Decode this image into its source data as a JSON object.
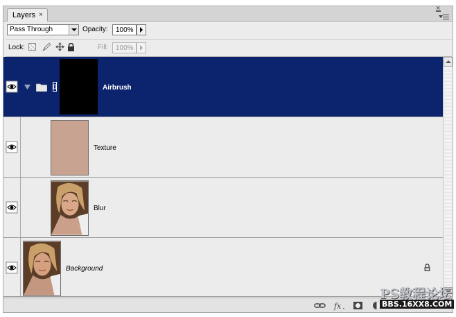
{
  "panel": {
    "tab_label": "Layers",
    "tab_close": "×",
    "close_glyph": "×"
  },
  "options": {
    "blend_mode": "Pass Through",
    "opacity_label": "Opacity:",
    "opacity_value": "100%",
    "lock_label": "Lock:",
    "fill_label": "Fill:",
    "fill_value": "100%"
  },
  "layers": [
    {
      "name": "Airbrush",
      "type": "group",
      "selected": true,
      "visible": true
    },
    {
      "name": "Texture",
      "type": "clipped",
      "visible": true
    },
    {
      "name": "Blur",
      "type": "clipped",
      "visible": true
    },
    {
      "name": "Background",
      "type": "background",
      "visible": true,
      "locked": true
    }
  ],
  "bottom_icons": [
    "link-layers-icon",
    "fx-icon",
    "layer-mask-icon",
    "adjustment-layer-icon"
  ],
  "watermark": {
    "brand": "PS教程论坛",
    "url": "BBS.16XX8.COM"
  },
  "colors": {
    "selection": "#0c246e",
    "panel_bg": "#ececec",
    "texture_fill": "#c8a392"
  }
}
